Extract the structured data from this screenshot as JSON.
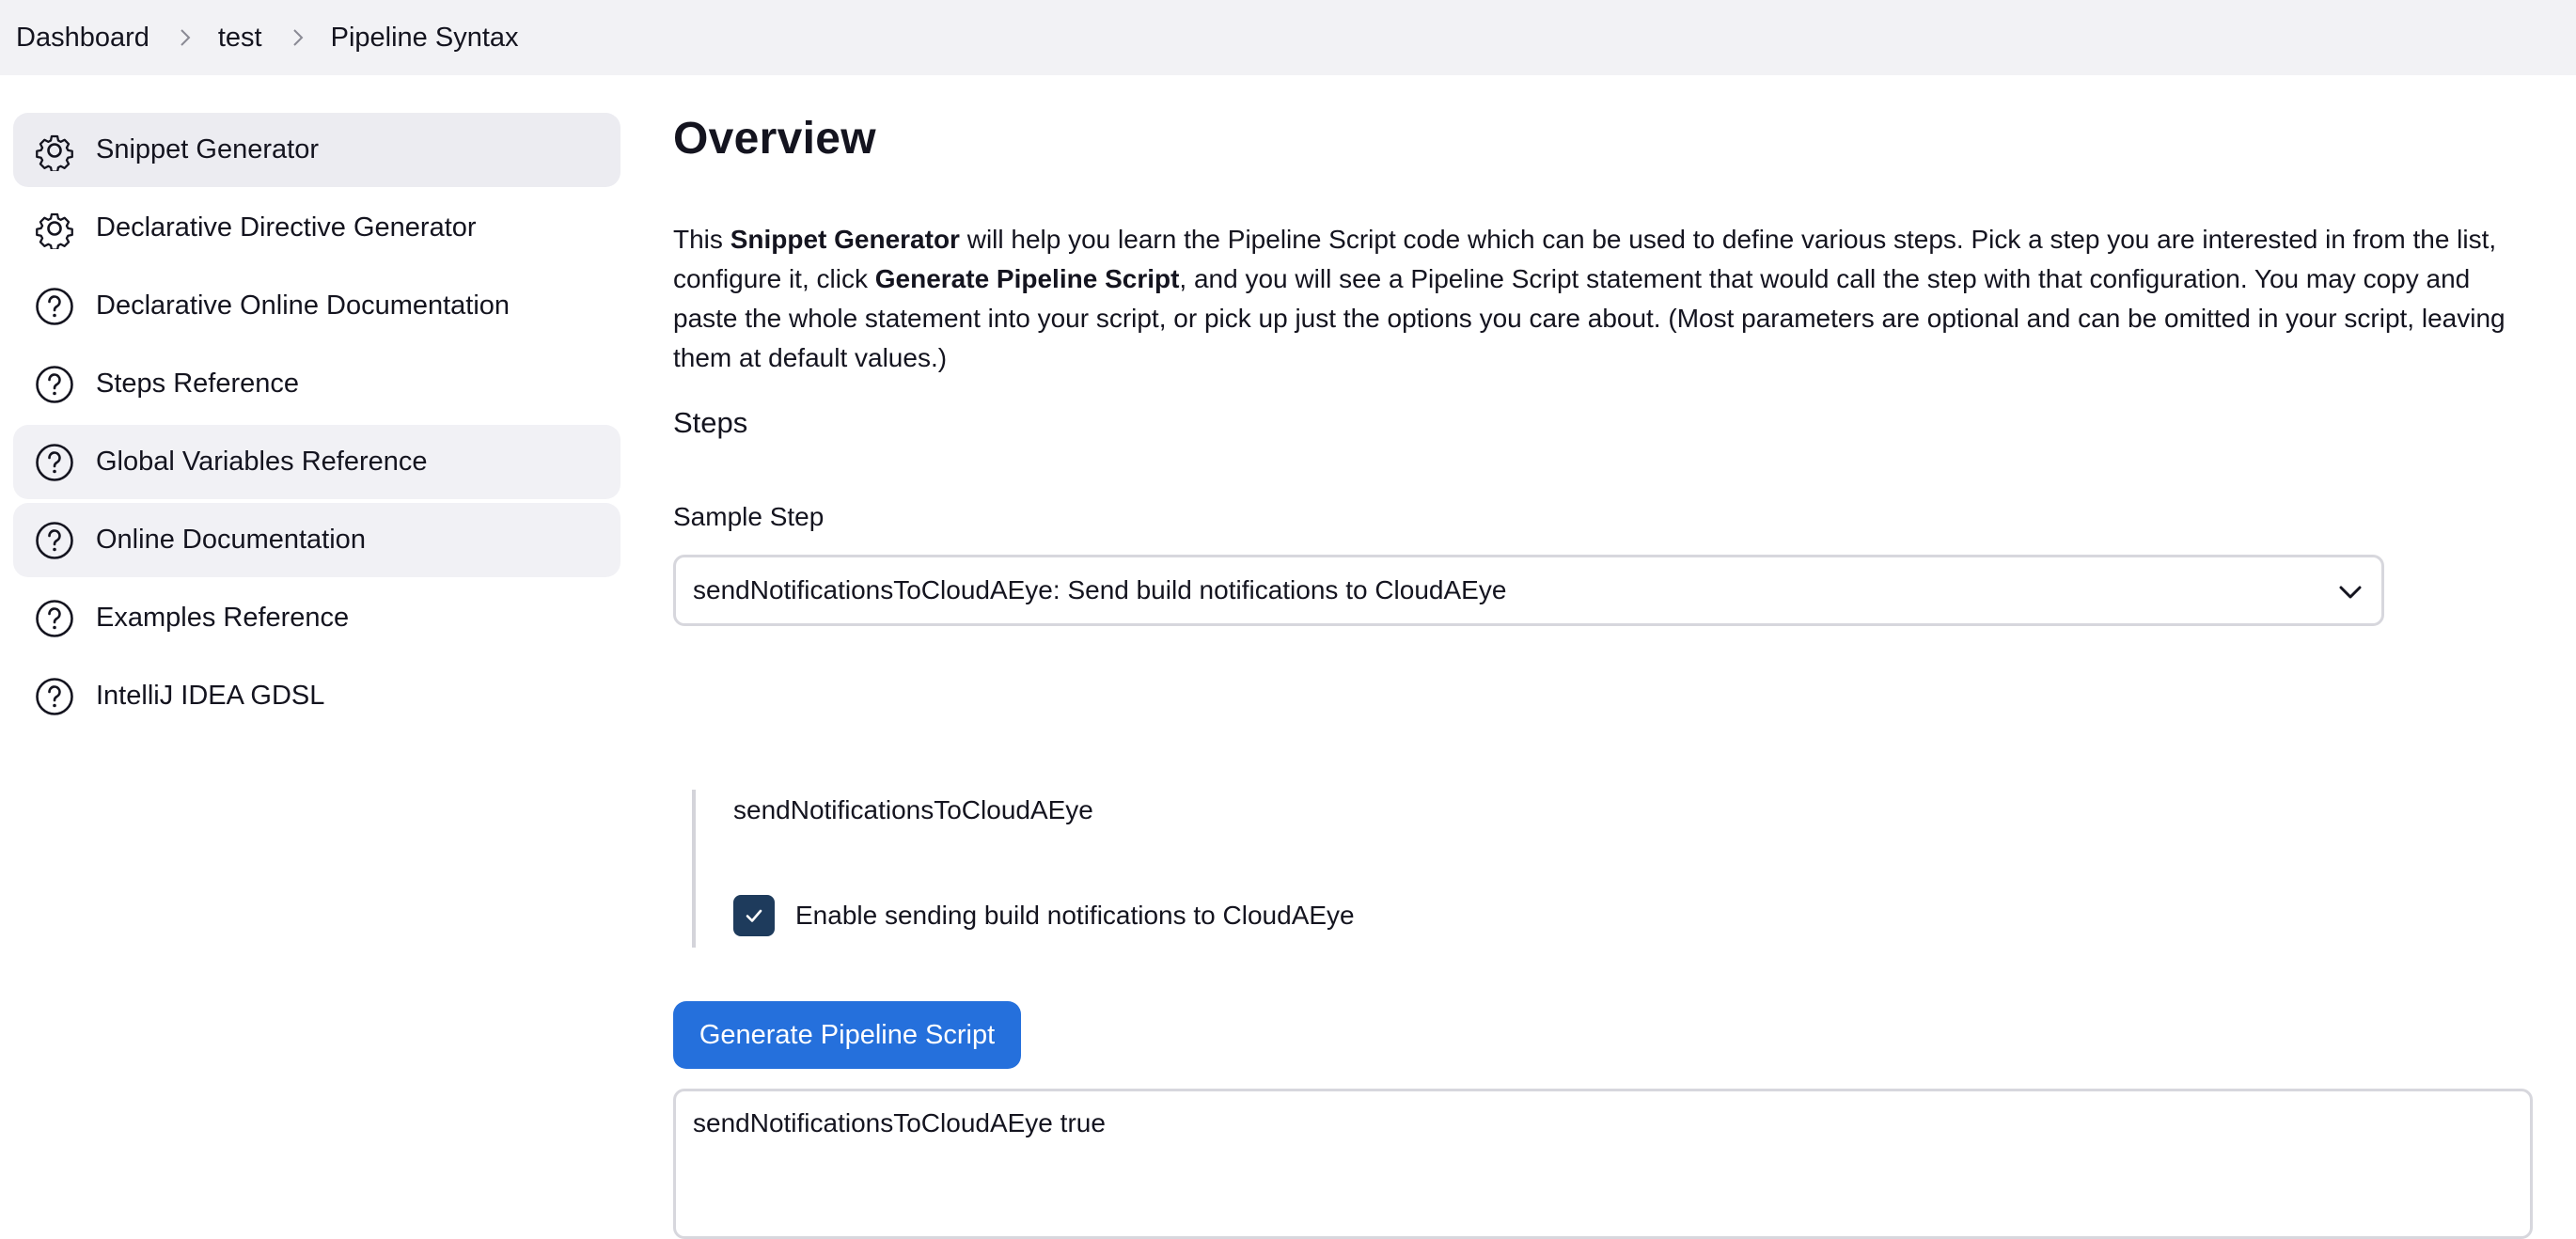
{
  "breadcrumb": {
    "items": [
      "Dashboard",
      "test",
      "Pipeline Syntax"
    ]
  },
  "sidebar": {
    "items": [
      {
        "label": "Snippet Generator",
        "icon": "gear-icon",
        "state": "active"
      },
      {
        "label": "Declarative Directive Generator",
        "icon": "gear-icon",
        "state": ""
      },
      {
        "label": "Declarative Online Documentation",
        "icon": "help-circle-icon",
        "state": ""
      },
      {
        "label": "Steps Reference",
        "icon": "help-circle-icon",
        "state": ""
      },
      {
        "label": "Global Variables Reference",
        "icon": "help-circle-icon",
        "state": "hovered"
      },
      {
        "label": "Online Documentation",
        "icon": "help-circle-icon",
        "state": "hovered"
      },
      {
        "label": "Examples Reference",
        "icon": "help-circle-icon",
        "state": ""
      },
      {
        "label": "IntelliJ IDEA GDSL",
        "icon": "help-circle-icon",
        "state": ""
      }
    ]
  },
  "main": {
    "title": "Overview",
    "intro": {
      "p1": "This ",
      "b1": "Snippet Generator",
      "p2": " will help you learn the Pipeline Script code which can be used to define various steps. Pick a step you are interested in from the list, configure it, click ",
      "b2": "Generate Pipeline Script",
      "p3": ", and you will see a Pipeline Script statement that would call the step with that configuration. You may copy and paste the whole statement into your script, or pick up just the options you care about. (Most parameters are optional and can be omitted in your script, leaving them at default values.)"
    },
    "steps_title": "Steps",
    "sample_step_label": "Sample Step",
    "sample_step_value": "sendNotificationsToCloudAEye: Send build notifications to CloudAEye",
    "config_title": "sendNotificationsToCloudAEye",
    "checkbox": {
      "label": "Enable sending build notifications to CloudAEye",
      "checked": true
    },
    "generate_button": "Generate Pipeline Script",
    "script_output": "sendNotificationsToCloudAEye true"
  },
  "colors": {
    "accent": "#2570dc",
    "checkbox": "#1e3b5c",
    "sidebar_active": "#ececf1",
    "breadcrumb_bg": "#f2f2f5"
  }
}
